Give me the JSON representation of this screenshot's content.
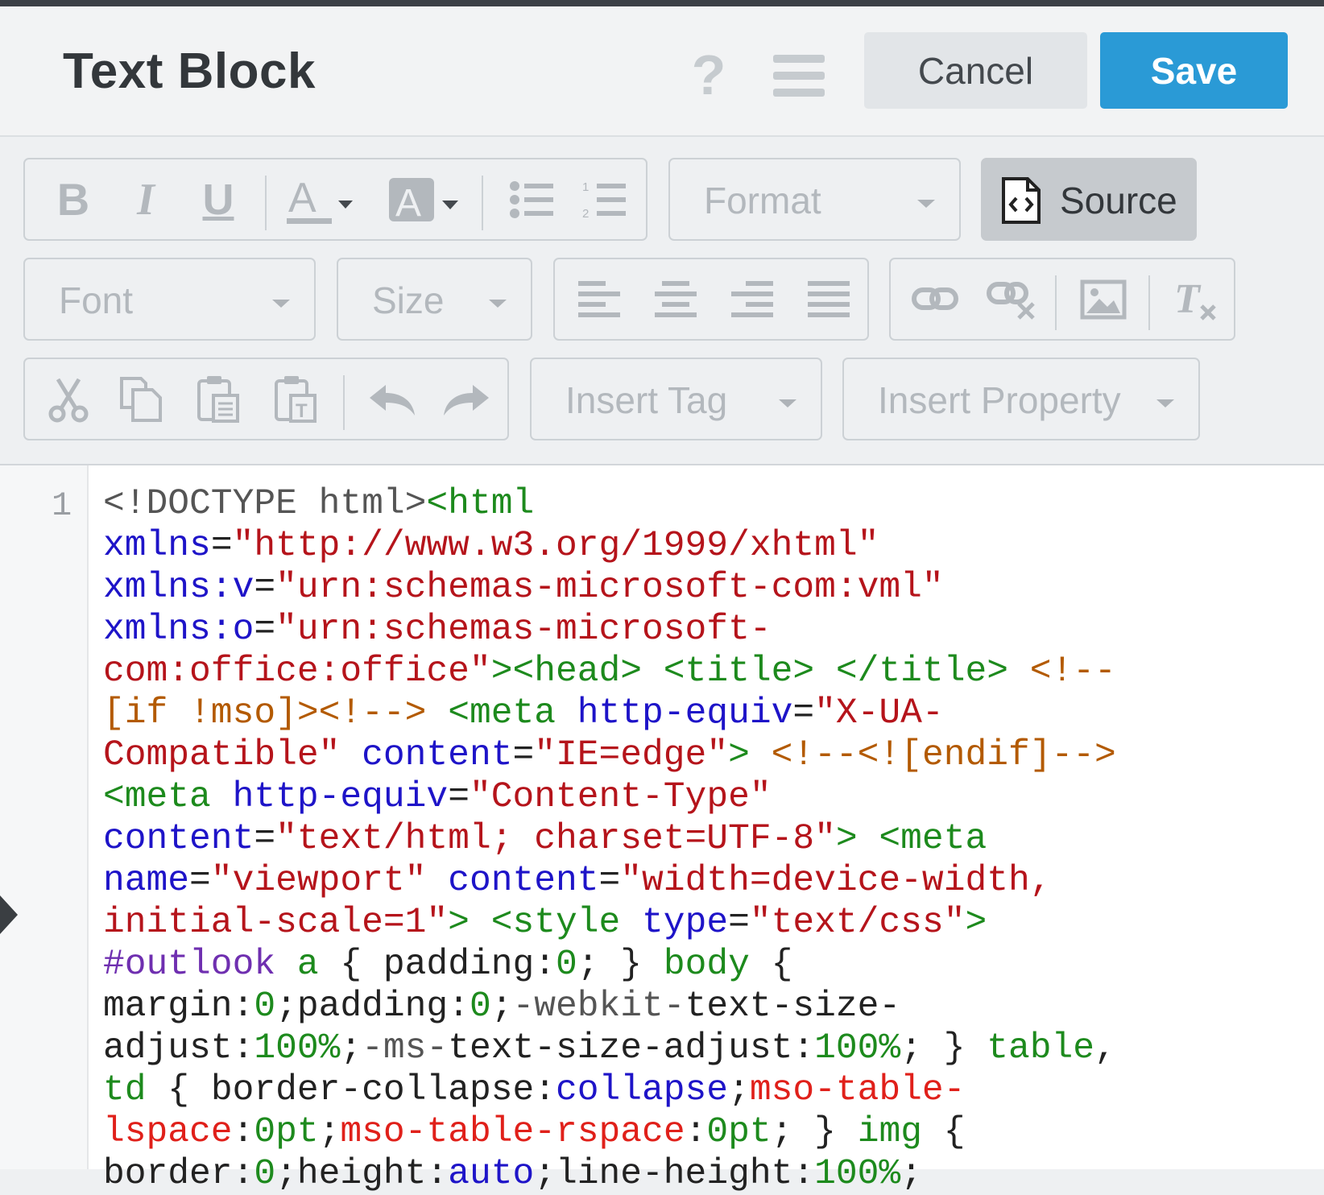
{
  "header": {
    "title": "Text Block",
    "cancel_label": "Cancel",
    "save_label": "Save"
  },
  "toolbar": {
    "format_label": "Format",
    "source_label": "Source",
    "font_label": "Font",
    "size_label": "Size",
    "insert_tag_label": "Insert Tag",
    "insert_property_label": "Insert Property",
    "icons": [
      "bold-icon",
      "italic-icon",
      "underline-icon",
      "text-color-icon",
      "background-color-icon",
      "bulleted-list-icon",
      "numbered-list-icon",
      "source-icon",
      "align-left-icon",
      "align-center-icon",
      "align-right-icon",
      "align-justify-icon",
      "link-icon",
      "unlink-icon",
      "image-icon",
      "remove-format-icon",
      "cut-icon",
      "copy-icon",
      "paste-icon",
      "paste-text-icon",
      "undo-icon",
      "redo-icon"
    ]
  },
  "editor": {
    "line_number": "1",
    "segments": [
      {
        "cls": "gr",
        "t": "<!DOCTYPE html>"
      },
      {
        "cls": "tg",
        "t": "<html"
      },
      {
        "cls": "",
        "t": "\n"
      },
      {
        "cls": "at",
        "t": "xmlns"
      },
      {
        "cls": "",
        "t": "="
      },
      {
        "cls": "st",
        "t": "\"http://www.w3.org/1999/xhtml\""
      },
      {
        "cls": "",
        "t": "\n"
      },
      {
        "cls": "at",
        "t": "xmlns:v"
      },
      {
        "cls": "",
        "t": "="
      },
      {
        "cls": "st",
        "t": "\"urn:schemas-microsoft-com:vml\""
      },
      {
        "cls": "",
        "t": "\n"
      },
      {
        "cls": "at",
        "t": "xmlns:o"
      },
      {
        "cls": "",
        "t": "="
      },
      {
        "cls": "st",
        "t": "\"urn:schemas-microsoft-\ncom:office:office\""
      },
      {
        "cls": "tg",
        "t": "><head>"
      },
      {
        "cls": "",
        "t": " "
      },
      {
        "cls": "tg",
        "t": "<title>"
      },
      {
        "cls": "",
        "t": " "
      },
      {
        "cls": "tg",
        "t": "</title>"
      },
      {
        "cls": "",
        "t": " "
      },
      {
        "cls": "cm",
        "t": "<!--\n[if !mso]><!-->"
      },
      {
        "cls": "",
        "t": " "
      },
      {
        "cls": "tg",
        "t": "<meta"
      },
      {
        "cls": "",
        "t": " "
      },
      {
        "cls": "at",
        "t": "http-equiv"
      },
      {
        "cls": "",
        "t": "="
      },
      {
        "cls": "st",
        "t": "\"X-UA-\nCompatible\""
      },
      {
        "cls": "",
        "t": " "
      },
      {
        "cls": "at",
        "t": "content"
      },
      {
        "cls": "",
        "t": "="
      },
      {
        "cls": "st",
        "t": "\"IE=edge\""
      },
      {
        "cls": "tg",
        "t": ">"
      },
      {
        "cls": "",
        "t": " "
      },
      {
        "cls": "cm",
        "t": "<!--<![endif]-->"
      },
      {
        "cls": "",
        "t": "\n"
      },
      {
        "cls": "tg",
        "t": "<meta"
      },
      {
        "cls": "",
        "t": " "
      },
      {
        "cls": "at",
        "t": "http-equiv"
      },
      {
        "cls": "",
        "t": "="
      },
      {
        "cls": "st",
        "t": "\"Content-Type\""
      },
      {
        "cls": "",
        "t": "\n"
      },
      {
        "cls": "at",
        "t": "content"
      },
      {
        "cls": "",
        "t": "="
      },
      {
        "cls": "st",
        "t": "\"text/html; charset=UTF-8\""
      },
      {
        "cls": "tg",
        "t": ">"
      },
      {
        "cls": "",
        "t": " "
      },
      {
        "cls": "tg",
        "t": "<meta"
      },
      {
        "cls": "",
        "t": "\n"
      },
      {
        "cls": "at",
        "t": "name"
      },
      {
        "cls": "",
        "t": "="
      },
      {
        "cls": "st",
        "t": "\"viewport\""
      },
      {
        "cls": "",
        "t": " "
      },
      {
        "cls": "at",
        "t": "content"
      },
      {
        "cls": "",
        "t": "="
      },
      {
        "cls": "st",
        "t": "\"width=device-width,\ninitial-scale=1\""
      },
      {
        "cls": "tg",
        "t": ">"
      },
      {
        "cls": "",
        "t": " "
      },
      {
        "cls": "tg",
        "t": "<style"
      },
      {
        "cls": "",
        "t": " "
      },
      {
        "cls": "at",
        "t": "type"
      },
      {
        "cls": "",
        "t": "="
      },
      {
        "cls": "st",
        "t": "\"text/css\""
      },
      {
        "cls": "tg",
        "t": ">"
      },
      {
        "cls": "",
        "t": "\n"
      },
      {
        "cls": "kw",
        "t": "#outlook"
      },
      {
        "cls": "",
        "t": " "
      },
      {
        "cls": "nm",
        "t": "a"
      },
      {
        "cls": "",
        "t": " { padding:"
      },
      {
        "cls": "nm",
        "t": "0"
      },
      {
        "cls": "",
        "t": "; } "
      },
      {
        "cls": "nm",
        "t": "body"
      },
      {
        "cls": "",
        "t": " {\nmargin:"
      },
      {
        "cls": "nm",
        "t": "0"
      },
      {
        "cls": "",
        "t": ";padding:"
      },
      {
        "cls": "nm",
        "t": "0"
      },
      {
        "cls": "",
        "t": ";"
      },
      {
        "cls": "gr",
        "t": "-webkit-"
      },
      {
        "cls": "",
        "t": "text-size-\nadjust:"
      },
      {
        "cls": "nm",
        "t": "100%"
      },
      {
        "cls": "",
        "t": ";"
      },
      {
        "cls": "gr",
        "t": "-ms-"
      },
      {
        "cls": "",
        "t": "text-size-adjust:"
      },
      {
        "cls": "nm",
        "t": "100%"
      },
      {
        "cls": "",
        "t": "; } "
      },
      {
        "cls": "nm",
        "t": "table"
      },
      {
        "cls": "",
        "t": ",\n"
      },
      {
        "cls": "nm",
        "t": "td"
      },
      {
        "cls": "",
        "t": " { border-collapse:"
      },
      {
        "cls": "at",
        "t": "collapse"
      },
      {
        "cls": "",
        "t": ";"
      },
      {
        "cls": "pr",
        "t": "mso-table-\nlspace"
      },
      {
        "cls": "",
        "t": ":"
      },
      {
        "cls": "nm",
        "t": "0pt"
      },
      {
        "cls": "",
        "t": ";"
      },
      {
        "cls": "pr",
        "t": "mso-table-rspace"
      },
      {
        "cls": "",
        "t": ":"
      },
      {
        "cls": "nm",
        "t": "0pt"
      },
      {
        "cls": "",
        "t": "; } "
      },
      {
        "cls": "nm",
        "t": "img"
      },
      {
        "cls": "",
        "t": " {\nborder:"
      },
      {
        "cls": "nm",
        "t": "0"
      },
      {
        "cls": "",
        "t": ";height:"
      },
      {
        "cls": "at",
        "t": "auto"
      },
      {
        "cls": "",
        "t": ";line-height:"
      },
      {
        "cls": "nm",
        "t": "100%"
      },
      {
        "cls": "",
        "t": ";"
      }
    ]
  }
}
